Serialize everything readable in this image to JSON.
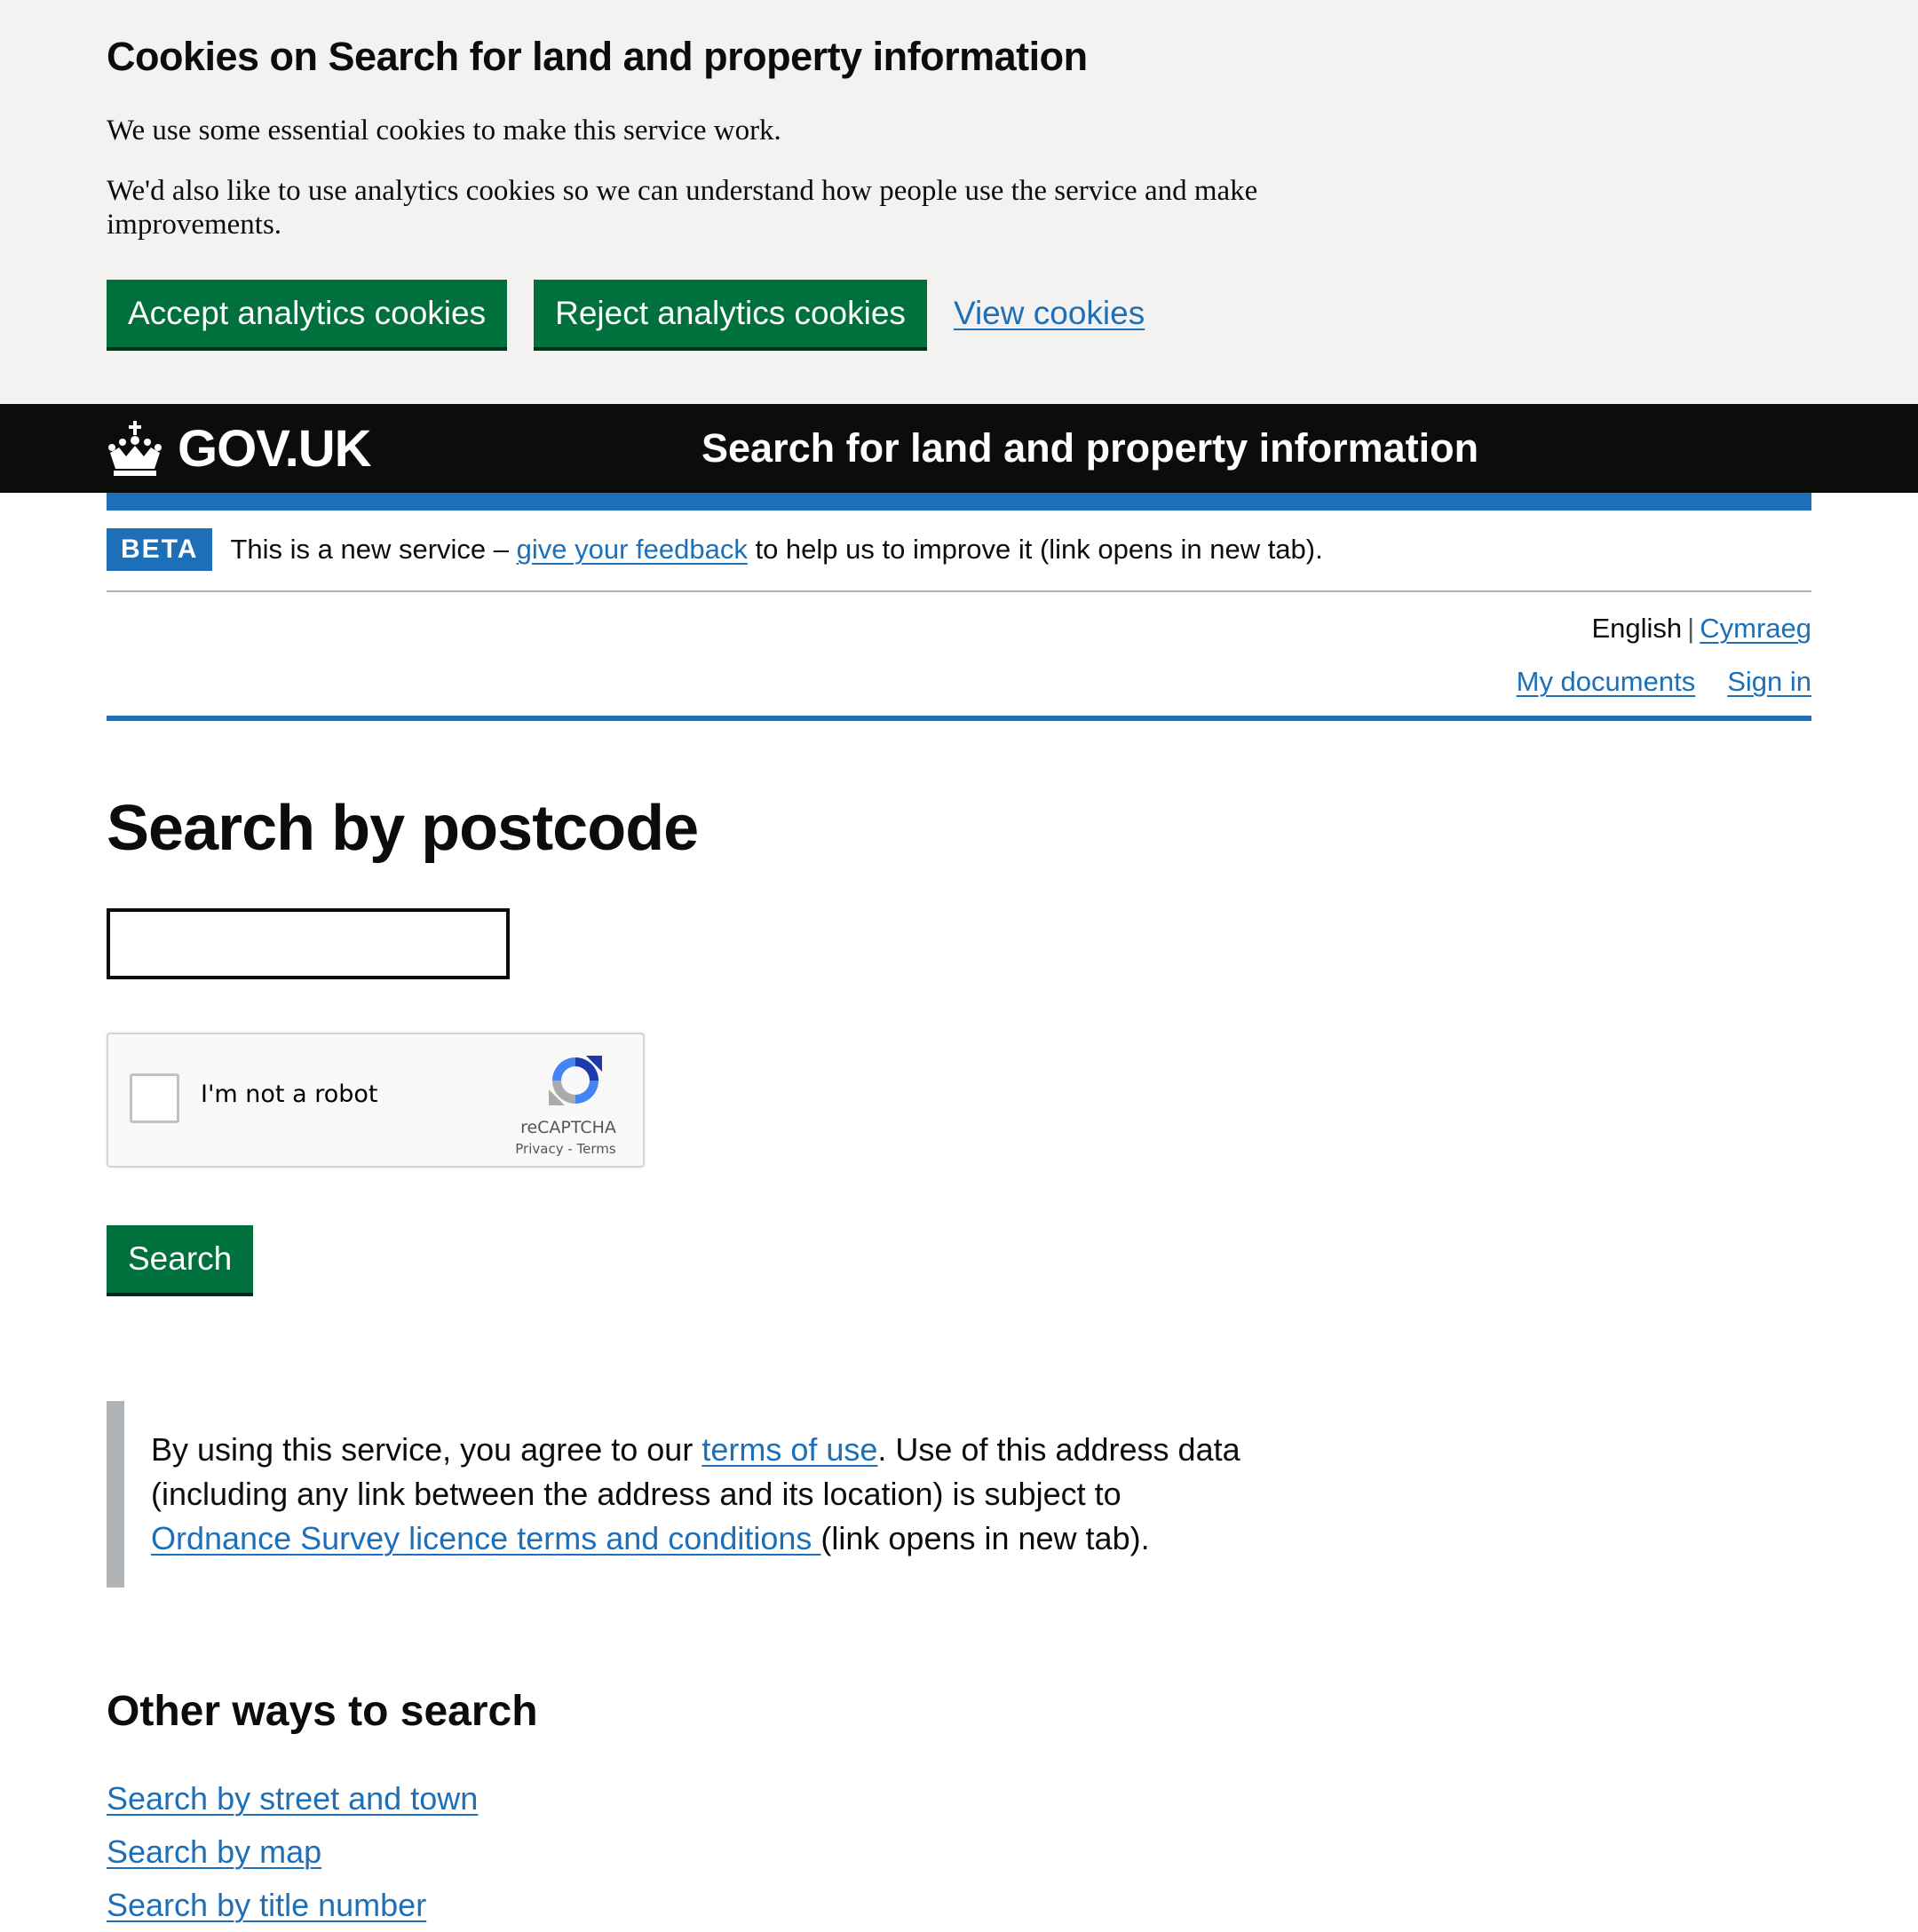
{
  "cookie_banner": {
    "title": "Cookies on Search for land and property information",
    "text1": "We use some essential cookies to make this service work.",
    "text2": "We'd also like to use analytics cookies so we can understand how people use the service and make improvements.",
    "accept_label": "Accept analytics cookies",
    "reject_label": "Reject analytics cookies",
    "view_label": "View cookies"
  },
  "header": {
    "logo_text": "GOV.UK",
    "service_name": "Search for land and property information"
  },
  "phase_banner": {
    "tag": "BETA",
    "text_before": "This is a new service – ",
    "feedback_link": "give your feedback",
    "text_after": " to help us to improve it (link opens in new tab)."
  },
  "language": {
    "current": "English",
    "separator": "|",
    "other": "Cymraeg"
  },
  "nav": {
    "my_documents": "My documents",
    "sign_in": "Sign in"
  },
  "main": {
    "title": "Search by postcode",
    "postcode_value": "",
    "search_label": "Search"
  },
  "recaptcha": {
    "label": "I'm not a robot",
    "brand": "reCAPTCHA",
    "privacy": "Privacy",
    "links_sep": " - ",
    "terms": "Terms"
  },
  "inset": {
    "t1": "By using this service, you agree to our ",
    "link1": "terms of use",
    "t2": ". Use of this address data (including any link between the address and its location) is subject to ",
    "link2": "Ordnance Survey licence terms and conditions ",
    "t3": "(link opens in new tab)."
  },
  "other_ways": {
    "heading": "Other ways to search",
    "links": [
      "Search by street and town",
      "Search by map",
      "Search by title number"
    ]
  },
  "colors": {
    "accent_blue": "#1d70b8",
    "button_green": "#00703c",
    "header_black": "#0b0c0c",
    "banner_grey": "#f3f2f1"
  }
}
